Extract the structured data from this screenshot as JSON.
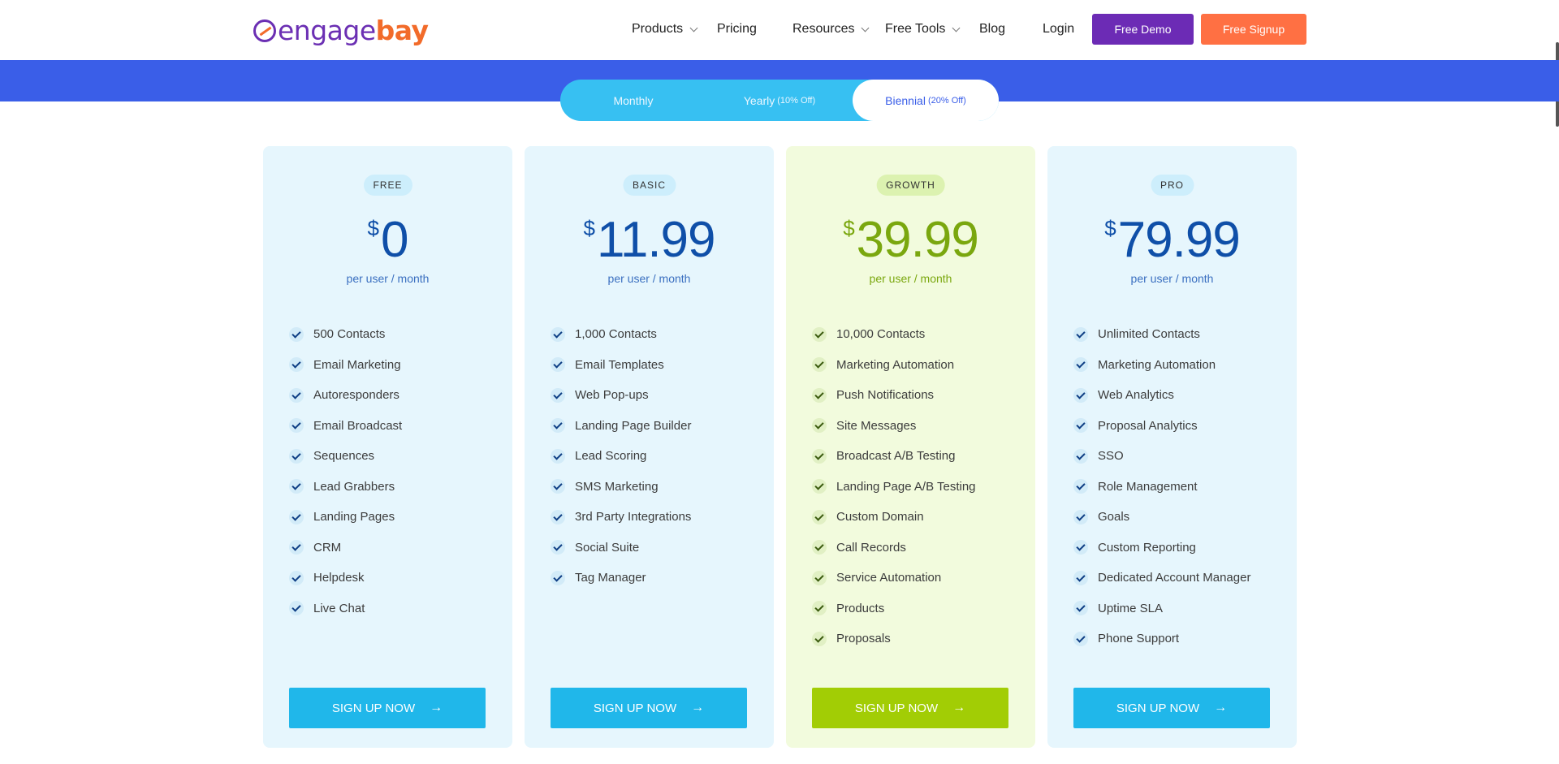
{
  "header": {
    "logo": {
      "part1": "engage",
      "part2": "bay"
    },
    "nav": [
      {
        "label": "Products",
        "dropdown": true
      },
      {
        "label": "Pricing",
        "dropdown": false
      },
      {
        "label": "Resources",
        "dropdown": true
      },
      {
        "label": "Free Tools",
        "dropdown": true
      },
      {
        "label": "Blog",
        "dropdown": false
      },
      {
        "label": "Login",
        "dropdown": false
      }
    ],
    "demo_button": "Free Demo",
    "signup_button": "Free Signup"
  },
  "billing_toggle": {
    "monthly": "Monthly",
    "yearly": "Yearly",
    "yearly_note": "(10% Off)",
    "biennial": "Biennial",
    "biennial_note": "(20% Off)",
    "selected": "biennial"
  },
  "plans": [
    {
      "name": "FREE",
      "currency": "$",
      "price": "0",
      "period": "per user / month",
      "features": [
        "500 Contacts",
        "Email Marketing",
        "Autoresponders",
        "Email Broadcast",
        "Sequences",
        "Lead Grabbers",
        "Landing Pages",
        "CRM",
        "Helpdesk",
        "Live Chat"
      ],
      "cta": "SIGN UP NOW"
    },
    {
      "name": "BASIC",
      "currency": "$",
      "price": "11.99",
      "period": "per user / month",
      "features": [
        "1,000 Contacts",
        "Email Templates",
        "Web Pop-ups",
        "Landing Page Builder",
        "Lead Scoring",
        "SMS Marketing",
        "3rd Party Integrations",
        "Social Suite",
        "Tag Manager"
      ],
      "cta": "SIGN UP NOW"
    },
    {
      "name": "GROWTH",
      "currency": "$",
      "price": "39.99",
      "period": "per user / month",
      "features": [
        "10,000 Contacts",
        "Marketing Automation",
        "Push Notifications",
        "Site Messages",
        "Broadcast A/B Testing",
        "Landing Page A/B Testing",
        "Custom Domain",
        "Call Records",
        "Service Automation",
        "Products",
        "Proposals"
      ],
      "cta": "SIGN UP NOW"
    },
    {
      "name": "PRO",
      "currency": "$",
      "price": "79.99",
      "period": "per user / month",
      "features": [
        "Unlimited Contacts",
        "Marketing Automation",
        "Web Analytics",
        "Proposal Analytics",
        "SSO",
        "Role Management",
        "Goals",
        "Custom Reporting",
        "Dedicated Account Manager",
        "Uptime SLA",
        "Phone Support"
      ],
      "cta": "SIGN UP NOW"
    }
  ],
  "colors": {
    "brand_purple": "#6c2bb5",
    "brand_orange": "#ff7043",
    "band_blue": "#3a5ee8",
    "toggle_cyan": "#37c0f2",
    "cta_blue": "#20b7ea",
    "cta_green": "#a2cd05"
  }
}
